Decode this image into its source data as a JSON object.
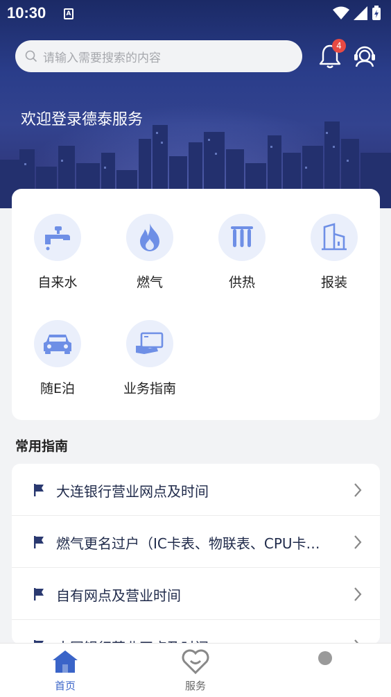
{
  "status_bar": {
    "time": "10:30",
    "sim_label": "A"
  },
  "search": {
    "placeholder": "请输入需要搜索的内容"
  },
  "notifications": {
    "count": "4"
  },
  "welcome": "欢迎登录德泰服务",
  "services": [
    {
      "label": "自来水",
      "icon": "water-tap-icon"
    },
    {
      "label": "燃气",
      "icon": "flame-icon"
    },
    {
      "label": "供热",
      "icon": "radiator-icon"
    },
    {
      "label": "报装",
      "icon": "building-icon"
    },
    {
      "label": "随E泊",
      "icon": "car-icon"
    },
    {
      "label": "业务指南",
      "icon": "guide-screen-icon"
    }
  ],
  "guides": {
    "title": "常用指南",
    "items": [
      "大连银行营业网点及时间",
      "燃气更名过户（IC卡表、物联表、CPU卡表）",
      "自有网点及营业时间",
      "大同银行营业网点及时间"
    ]
  },
  "bottom_nav": {
    "items": [
      {
        "label": "首页",
        "active": true
      },
      {
        "label": "服务",
        "active": false
      },
      {
        "label": "",
        "active": false
      }
    ]
  },
  "colors": {
    "accent": "#3a64c8",
    "icon_blue": "#6e8fe6",
    "icon_bg": "#eaeffb",
    "badge": "#e84a43",
    "guide_text": "#1f2a4a"
  }
}
